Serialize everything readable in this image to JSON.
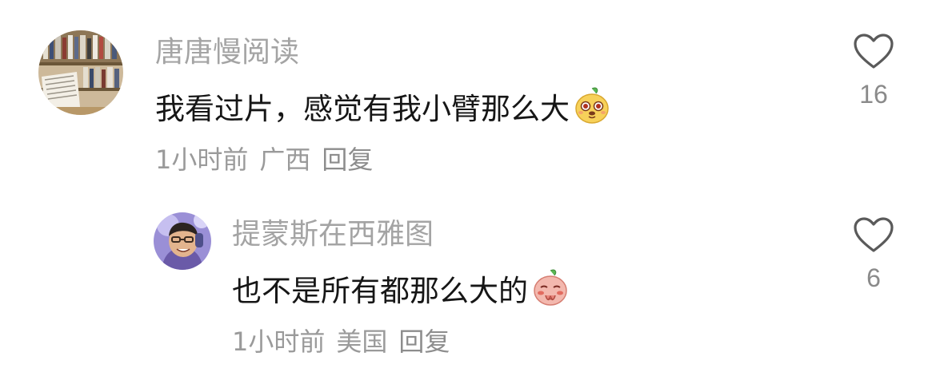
{
  "comments": [
    {
      "username": "唐唐慢阅读",
      "text": "我看过片，感觉有我小臂那么大",
      "emoji": "naughty-pear-emoji",
      "time": "1小时前",
      "location": "广西",
      "reply_label": "回复",
      "likes": "16"
    },
    {
      "username": "提蒙斯在西雅图",
      "text": "也不是所有都那么大的",
      "emoji": "shy-pear-emoji",
      "time": "1小时前",
      "location": "美国",
      "reply_label": "回复",
      "likes": "6"
    }
  ],
  "colors": {
    "username": "#a4a4a4",
    "text": "#161616",
    "meta": "#9a9a9a",
    "heart_outline": "#5a5a5a"
  }
}
